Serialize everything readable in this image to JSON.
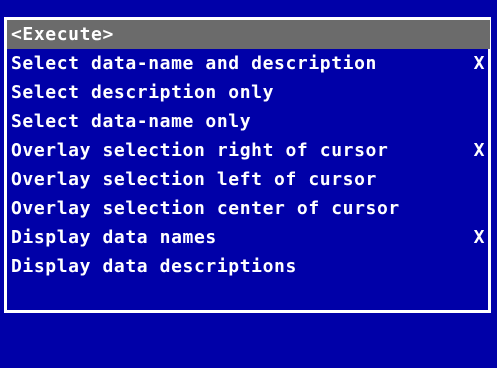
{
  "menu": {
    "items": [
      {
        "label": "<Execute>",
        "flag": ""
      },
      {
        "label": "Select data-name and description",
        "flag": "X"
      },
      {
        "label": "Select description only",
        "flag": ""
      },
      {
        "label": "Select data-name only",
        "flag": ""
      },
      {
        "label": "Overlay selection right of cursor",
        "flag": "X"
      },
      {
        "label": "Overlay selection left of cursor",
        "flag": ""
      },
      {
        "label": "Overlay selection center of cursor",
        "flag": ""
      },
      {
        "label": "Display data names",
        "flag": "X"
      },
      {
        "label": "Display data descriptions",
        "flag": ""
      }
    ],
    "selected_index": 0
  },
  "colors": {
    "background": "#0000A8",
    "border": "#FFFFFF",
    "text": "#FFFFFF",
    "highlight": "#6B6B6B"
  }
}
